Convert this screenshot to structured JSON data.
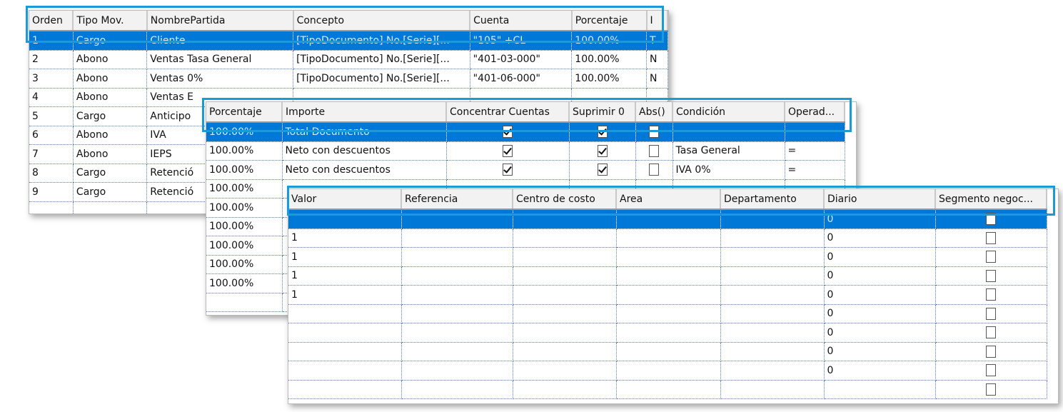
{
  "grid1": {
    "columns": [
      "Orden",
      "Tipo Mov.",
      "NombrePartida",
      "Concepto",
      "Cuenta",
      "Porcentaje",
      "I"
    ],
    "rows": [
      [
        "1",
        "Cargo",
        "Cliente",
        "[TipoDocumento] No.[Serie][...",
        "\"105\" +CL",
        "100.00%",
        "T"
      ],
      [
        "2",
        "Abono",
        "Ventas Tasa General",
        "[TipoDocumento] No.[Serie][...",
        "\"401-03-000\"",
        "100.00%",
        "N"
      ],
      [
        "3",
        "Abono",
        "Ventas 0%",
        "[TipoDocumento] No.[Serie][...",
        "\"401-06-000\"",
        "100.00%",
        "N"
      ],
      [
        "4",
        "Abono",
        "Ventas E",
        "",
        "",
        "",
        ""
      ],
      [
        "5",
        "Cargo",
        "Anticipo",
        "",
        "",
        "",
        ""
      ],
      [
        "6",
        "Abono",
        "IVA",
        "",
        "",
        "",
        ""
      ],
      [
        "7",
        "Abono",
        "IEPS",
        "",
        "",
        "",
        ""
      ],
      [
        "8",
        "Cargo",
        "Retenció",
        "",
        "",
        "",
        ""
      ],
      [
        "9",
        "Cargo",
        "Retenció",
        "",
        "",
        "",
        ""
      ],
      [
        "",
        "",
        "",
        "",
        "",
        "",
        ""
      ]
    ],
    "selected_row": 0
  },
  "grid2": {
    "columns": [
      "Porcentaje",
      "Importe",
      "Concentrar Cuentas",
      "Suprimir 0",
      "Abs()",
      "Condición",
      "Operad..."
    ],
    "rows": [
      {
        "porcentaje": "100.00%",
        "importe": "Total Documento",
        "concentrar": true,
        "suprimir": true,
        "abs": false,
        "condicion": "",
        "operador": ""
      },
      {
        "porcentaje": "100.00%",
        "importe": "Neto con descuentos",
        "concentrar": true,
        "suprimir": true,
        "abs": false,
        "condicion": "Tasa General",
        "operador": "="
      },
      {
        "porcentaje": "100.00%",
        "importe": "Neto con descuentos",
        "concentrar": true,
        "suprimir": true,
        "abs": false,
        "condicion": "IVA 0%",
        "operador": "="
      },
      {
        "porcentaje": "100.00%"
      },
      {
        "porcentaje": "100.00%"
      },
      {
        "porcentaje": "100.00%"
      },
      {
        "porcentaje": "100.00%"
      },
      {
        "porcentaje": "100.00%"
      },
      {
        "porcentaje": "100.00%"
      },
      {
        "porcentaje": ""
      }
    ],
    "selected_row": 0
  },
  "grid3": {
    "columns": [
      "Valor",
      "Referencia",
      "Centro de costo",
      "Area",
      "Departamento",
      "Diario",
      "Segmento negoc..."
    ],
    "rows": [
      {
        "valor": "",
        "diario": "0",
        "segmento": false
      },
      {
        "valor": "1",
        "diario": "0",
        "segmento": false
      },
      {
        "valor": "1",
        "diario": "0",
        "segmento": false
      },
      {
        "valor": "1",
        "diario": "0",
        "segmento": false
      },
      {
        "valor": "1",
        "diario": "0",
        "segmento": false
      },
      {
        "valor": "",
        "diario": "0",
        "segmento": false
      },
      {
        "valor": "",
        "diario": "0",
        "segmento": false
      },
      {
        "valor": "",
        "diario": "0",
        "segmento": false
      },
      {
        "valor": "",
        "diario": "0",
        "segmento": false
      },
      {
        "valor": "",
        "diario": "",
        "segmento": false
      }
    ],
    "selected_row": 0
  },
  "colors": {
    "selection": "#0078d7",
    "highlight": "#1a9ad6"
  }
}
